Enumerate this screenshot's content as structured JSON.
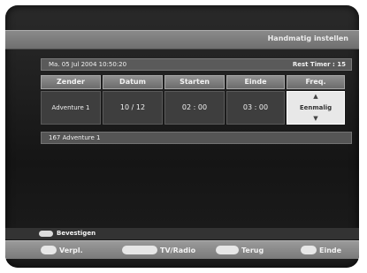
{
  "title": "Handmatig instellen",
  "datetime": "Ma. 05 Jul 2004 10:50:20",
  "rest_timer": "Rest Timer : 15",
  "columns": {
    "zender": "Zender",
    "datum": "Datum",
    "starten": "Starten",
    "einde": "Einde",
    "freq": "Freq."
  },
  "values": {
    "zender": "Adventure 1",
    "datum": "10 / 12",
    "starten": "02 : 00",
    "einde": "03 : 00",
    "freq": "Eenmalig"
  },
  "channel_info": "167  Adventure 1",
  "confirm_label": "Bevestigen",
  "nav": {
    "verpl": "Verpl.",
    "tvradio": "TV/Radio",
    "terug": "Terug",
    "einde": "Einde"
  },
  "icons": {
    "confirm": "ok-button-icon",
    "nav_move": "arrow-keys-icon",
    "tvradio": "tvradio-button-icon",
    "back": "back-button-icon",
    "exit": "exit-button-icon",
    "freq_up": "up-arrow-icon",
    "freq_down": "down-arrow-icon"
  }
}
